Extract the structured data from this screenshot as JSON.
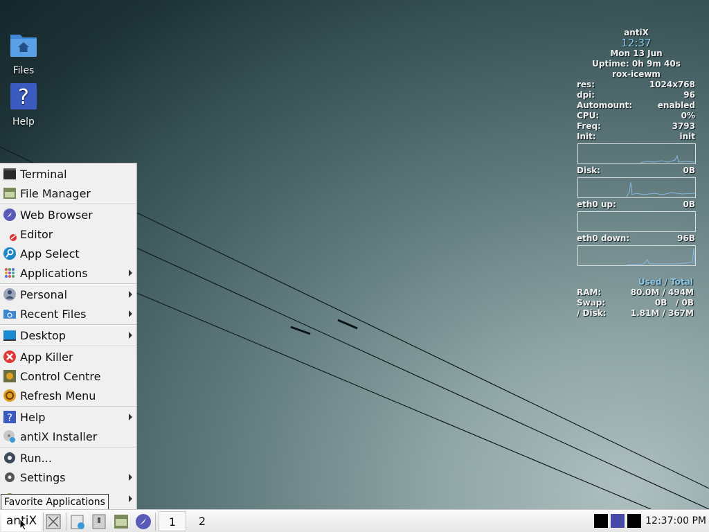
{
  "desktop": {
    "icons": [
      {
        "label": "Files",
        "icon": "folder-home-icon"
      },
      {
        "label": "Help",
        "icon": "help-icon"
      }
    ]
  },
  "conky": {
    "distro": "antiX",
    "time": "12:37",
    "date": "Mon 13 Jun",
    "uptime": "Uptime: 0h 9m 40s",
    "wm": "rox-icewm",
    "stats": [
      {
        "key": "res:",
        "value": "1024x768"
      },
      {
        "key": "dpi:",
        "value": "96"
      },
      {
        "key": "Automount:",
        "value": "enabled"
      },
      {
        "key": "CPU:",
        "value": "0%"
      },
      {
        "key": "Freq:",
        "value": "3793"
      },
      {
        "key": "Init:",
        "value": "init"
      }
    ],
    "disk": {
      "key": "Disk:",
      "value": "0B"
    },
    "eth_up": {
      "key": "eth0 up:",
      "value": "0B"
    },
    "eth_down": {
      "key": "eth0 down:",
      "value": "96B"
    },
    "used_total": "Used / Total",
    "memory": [
      {
        "key": "RAM:",
        "value": "80.0M / 494M"
      },
      {
        "key": "Swap:",
        "value": "0B   / 0B"
      },
      {
        "key": "/ Disk:",
        "value": "1.81M / 367M"
      }
    ],
    "colors": {
      "clock": "#8fd0f0",
      "graph": "#8ab8e0"
    }
  },
  "menu": {
    "items": [
      {
        "label": "Terminal",
        "icon": "terminal-icon"
      },
      {
        "label": "File Manager",
        "icon": "file-manager-icon"
      },
      {
        "label": "Web Browser",
        "icon": "web-browser-icon"
      },
      {
        "label": "Editor",
        "icon": "editor-icon"
      },
      {
        "label": "App Select",
        "icon": "app-select-icon"
      },
      {
        "label": "Applications",
        "icon": "applications-icon"
      },
      {
        "label": "Personal",
        "icon": "personal-icon"
      },
      {
        "label": "Recent Files",
        "icon": "recent-files-icon"
      },
      {
        "label": "Desktop",
        "icon": "desktop-icon"
      },
      {
        "label": "App Killer",
        "icon": "app-killer-icon"
      },
      {
        "label": "Control Centre",
        "icon": "control-centre-icon"
      },
      {
        "label": "Refresh Menu",
        "icon": "refresh-menu-icon"
      },
      {
        "label": "Help",
        "icon": "help-icon"
      },
      {
        "label": "antiX Installer",
        "icon": "installer-icon"
      },
      {
        "label": "Run...",
        "icon": "run-icon"
      },
      {
        "label": "Settings",
        "icon": "settings-icon"
      },
      {
        "label": "",
        "icon": "partially-hidden-item-icon"
      }
    ]
  },
  "tooltip": "Favorite Applications",
  "taskbar": {
    "start_label": "antiX",
    "workspaces": [
      "1",
      "2"
    ],
    "clock": "12:37:00 PM"
  }
}
